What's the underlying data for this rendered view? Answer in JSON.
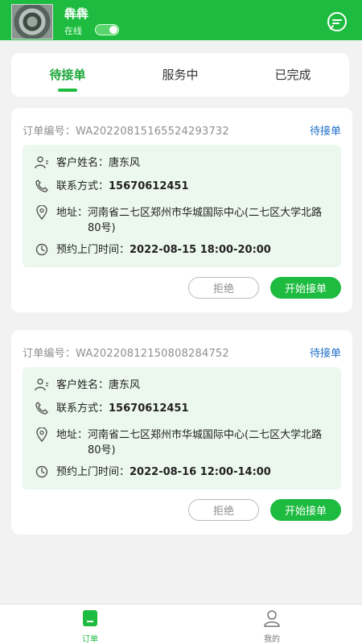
{
  "header": {
    "username": "犇犇",
    "status_label": "在线",
    "online_toggle_on": true
  },
  "tabs": [
    {
      "label": "待接单",
      "active": true
    },
    {
      "label": "服务中",
      "active": false
    },
    {
      "label": "已完成",
      "active": false
    }
  ],
  "orders": [
    {
      "order_no_label": "订单编号：",
      "order_no": "WA20220815165524293732",
      "status": "待接单",
      "customer_label": "客户姓名：",
      "customer": "唐东风",
      "contact_label": "联系方式：",
      "contact": "15670612451",
      "address_label": "地址：",
      "address": "河南省二七区郑州市华城国际中心(二七区大学北路80号)",
      "time_label": "预约上门时间：",
      "time": "2022-08-15 18:00-20:00",
      "reject_label": "拒绝",
      "accept_label": "开始接单"
    },
    {
      "order_no_label": "订单编号：",
      "order_no": "WA20220812150808284752",
      "status": "待接单",
      "customer_label": "客户姓名：",
      "customer": "唐东风",
      "contact_label": "联系方式：",
      "contact": "15670612451",
      "address_label": "地址：",
      "address": "河南省二七区郑州市华城国际中心(二七区大学北路80号)",
      "time_label": "预约上门时间：",
      "time": "2022-08-16 12:00-14:00",
      "reject_label": "拒绝",
      "accept_label": "开始接单"
    }
  ],
  "bottom_nav": [
    {
      "label": "订单",
      "icon": "order-icon",
      "active": true
    },
    {
      "label": "我的",
      "icon": "user-icon",
      "active": false
    }
  ],
  "colors": {
    "brand": "#1dbb3f",
    "status_link": "#1f6fc9",
    "info_bg": "#ecf8ee"
  }
}
